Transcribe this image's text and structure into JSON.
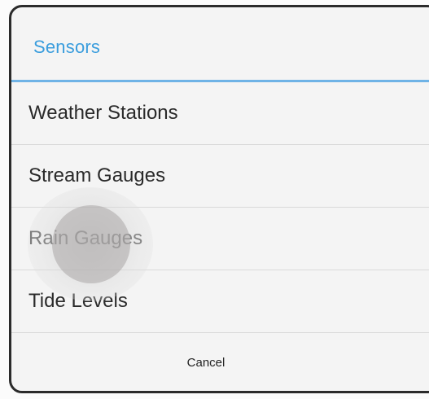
{
  "dialog": {
    "title": "Sensors",
    "options": [
      {
        "label": "Weather Stations"
      },
      {
        "label": "Stream Gauges"
      },
      {
        "label": "Rain Gauges"
      },
      {
        "label": "Tide Levels"
      }
    ],
    "cancel_label": "Cancel"
  },
  "colors": {
    "title": "#3a9ddd",
    "divider": "#6fb3e6",
    "background": "#f4f4f4"
  }
}
